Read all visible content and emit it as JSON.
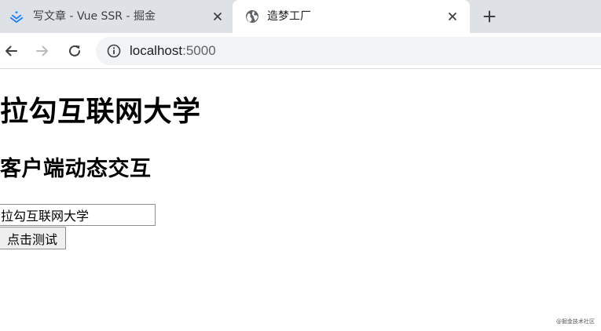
{
  "browser": {
    "tabs": [
      {
        "title": "写文章 - Vue SSR - 掘金",
        "icon": "juejin-logo-icon",
        "active": false
      },
      {
        "title": "造梦工厂",
        "icon": "globe-icon",
        "active": true
      }
    ],
    "address": {
      "host": "localhost",
      "port": ":5000"
    },
    "colors": {
      "tabstrip": "#dee1e6",
      "omnibox": "#f1f3f4",
      "juejin_blue": "#1e80ff"
    }
  },
  "page": {
    "heading": "拉勾互联网大学",
    "subheading": "客户端动态交互",
    "input_value": "拉勾互联网大学",
    "button_label": "点击测试"
  },
  "watermark": "@掘金技术社区"
}
